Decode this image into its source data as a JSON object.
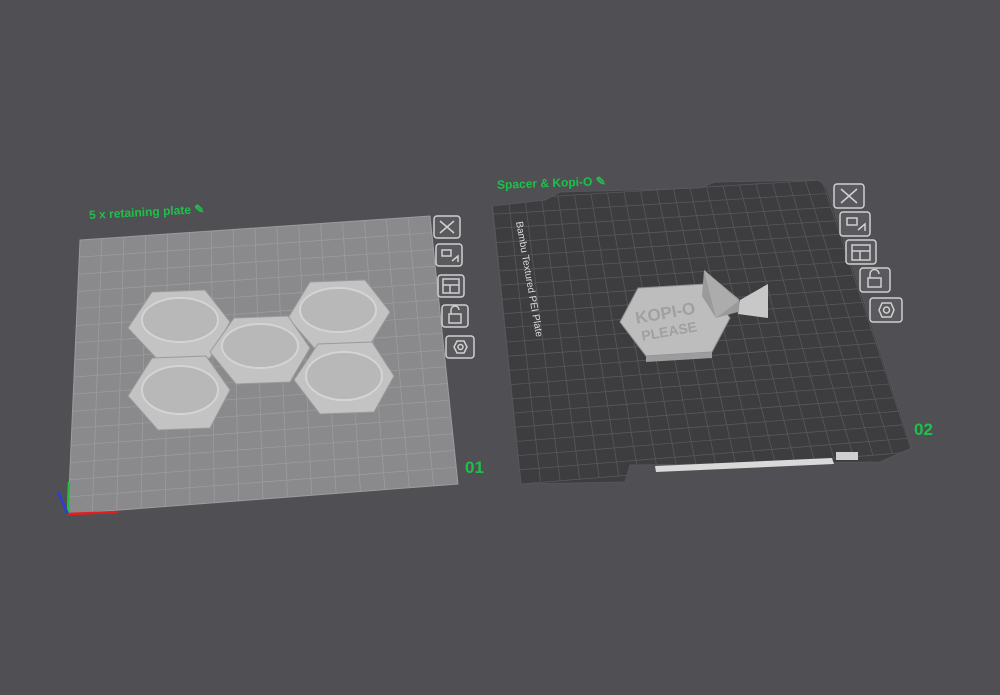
{
  "plates": [
    {
      "name": "5 x retaining plate",
      "number": "01",
      "parts_count": 5,
      "tools": [
        "close-icon",
        "auto-orient-icon",
        "arrange-icon",
        "lock-icon",
        "settings-icon"
      ]
    },
    {
      "name": "Spacer & Kopi-O",
      "number": "02",
      "bed_label": "Bambu Textured PEI Plate",
      "sign_line1": "KOPI-O",
      "sign_line2": "PLEASE",
      "tools": [
        "close-icon",
        "auto-orient-icon",
        "arrange-icon",
        "lock-icon",
        "settings-icon"
      ]
    }
  ],
  "axes": {
    "x_color": "#e02020",
    "y_color": "#22c040",
    "z_color": "#2b3fd8"
  },
  "colors": {
    "accent": "#1fc04a",
    "background": "#4f4f54"
  }
}
